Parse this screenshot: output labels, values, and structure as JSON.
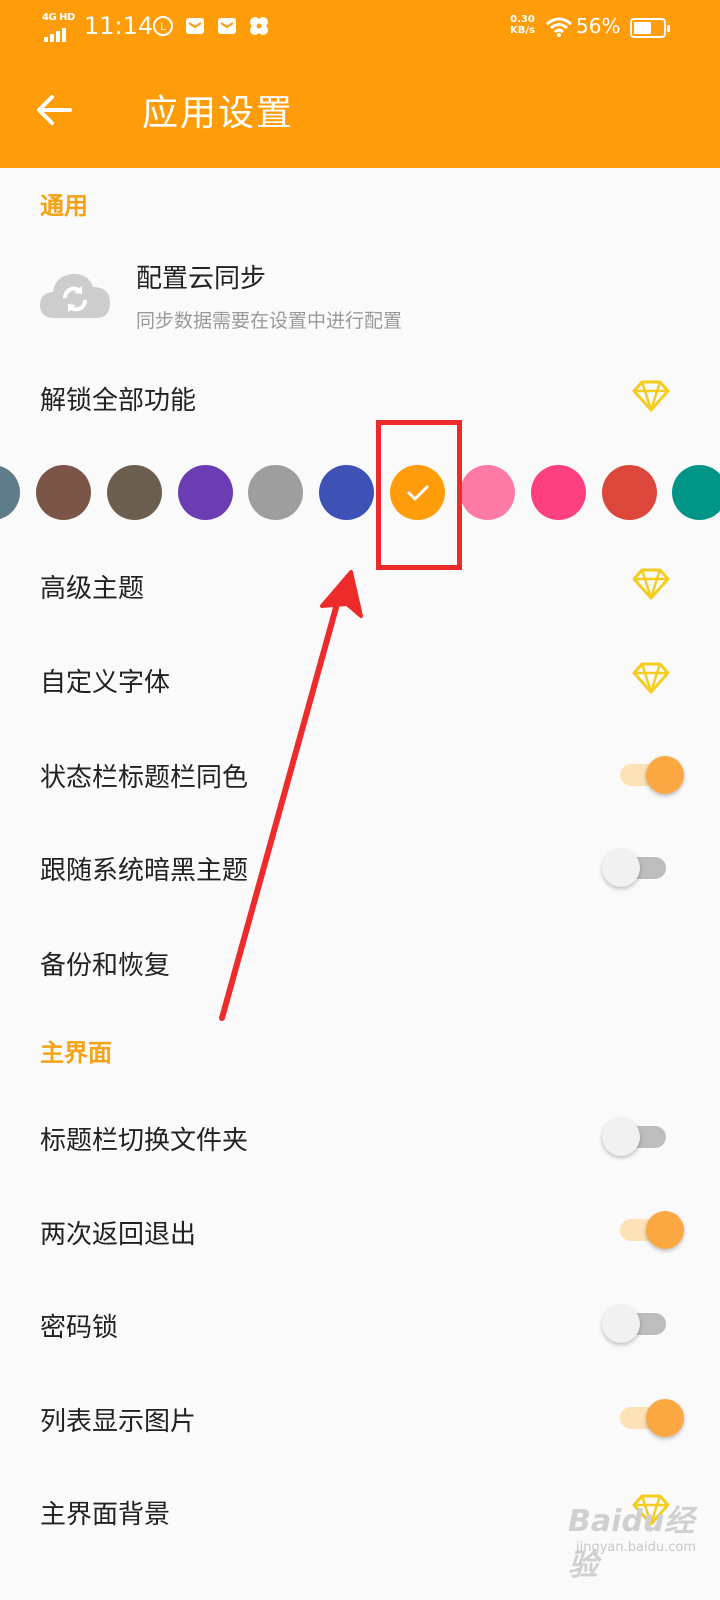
{
  "status_bar": {
    "network": "4G HD",
    "time": "11:14",
    "speed": "0.30\nKB/s",
    "battery_percent": "56%",
    "battery_level": 0.56
  },
  "app_bar": {
    "title": "应用设置",
    "color": "#fe9c0a"
  },
  "sections": {
    "general": "通用",
    "main_ui": "主界面"
  },
  "cloud_sync": {
    "title": "配置云同步",
    "subtitle": "同步数据需要在设置中进行配置"
  },
  "rows": {
    "unlock_all": "解锁全部功能",
    "advanced_theme": "高级主题",
    "custom_font": "自定义字体",
    "statusbar_same_color": "状态栏标题栏同色",
    "follow_dark": "跟随系统暗黑主题",
    "backup_restore": "备份和恢复",
    "titlebar_switch_folder": "标题栏切换文件夹",
    "double_back_exit": "两次返回退出",
    "password_lock": "密码锁",
    "list_show_images": "列表显示图片",
    "main_background": "主界面背景"
  },
  "toggles": {
    "statusbar_same_color": true,
    "follow_dark": false,
    "titlebar_switch_folder": false,
    "double_back_exit": true,
    "password_lock": false,
    "list_show_images": true
  },
  "theme_colors": [
    {
      "name": "blue-grey",
      "color": "#5f7c8a",
      "selected": false
    },
    {
      "name": "brown",
      "color": "#7a5548",
      "selected": false
    },
    {
      "name": "dark-brown",
      "color": "#6c5e4f",
      "selected": false
    },
    {
      "name": "purple",
      "color": "#6a3db4",
      "selected": false
    },
    {
      "name": "grey",
      "color": "#9e9e9e",
      "selected": false
    },
    {
      "name": "indigo",
      "color": "#3e51b5",
      "selected": false
    },
    {
      "name": "orange",
      "color": "#fe9c0a",
      "selected": true
    },
    {
      "name": "light-pink",
      "color": "#fd7aa4",
      "selected": false
    },
    {
      "name": "pink",
      "color": "#fe4080",
      "selected": false
    },
    {
      "name": "red",
      "color": "#dd463a",
      "selected": false
    },
    {
      "name": "teal",
      "color": "#009587",
      "selected": false
    }
  ],
  "accent": {
    "section_header": "#f4a316",
    "gem": "#f5cc20",
    "annotation_red": "#ee2b2b"
  },
  "watermark": {
    "main": "Baidu经验",
    "sub": "jingyan.baidu.com"
  }
}
